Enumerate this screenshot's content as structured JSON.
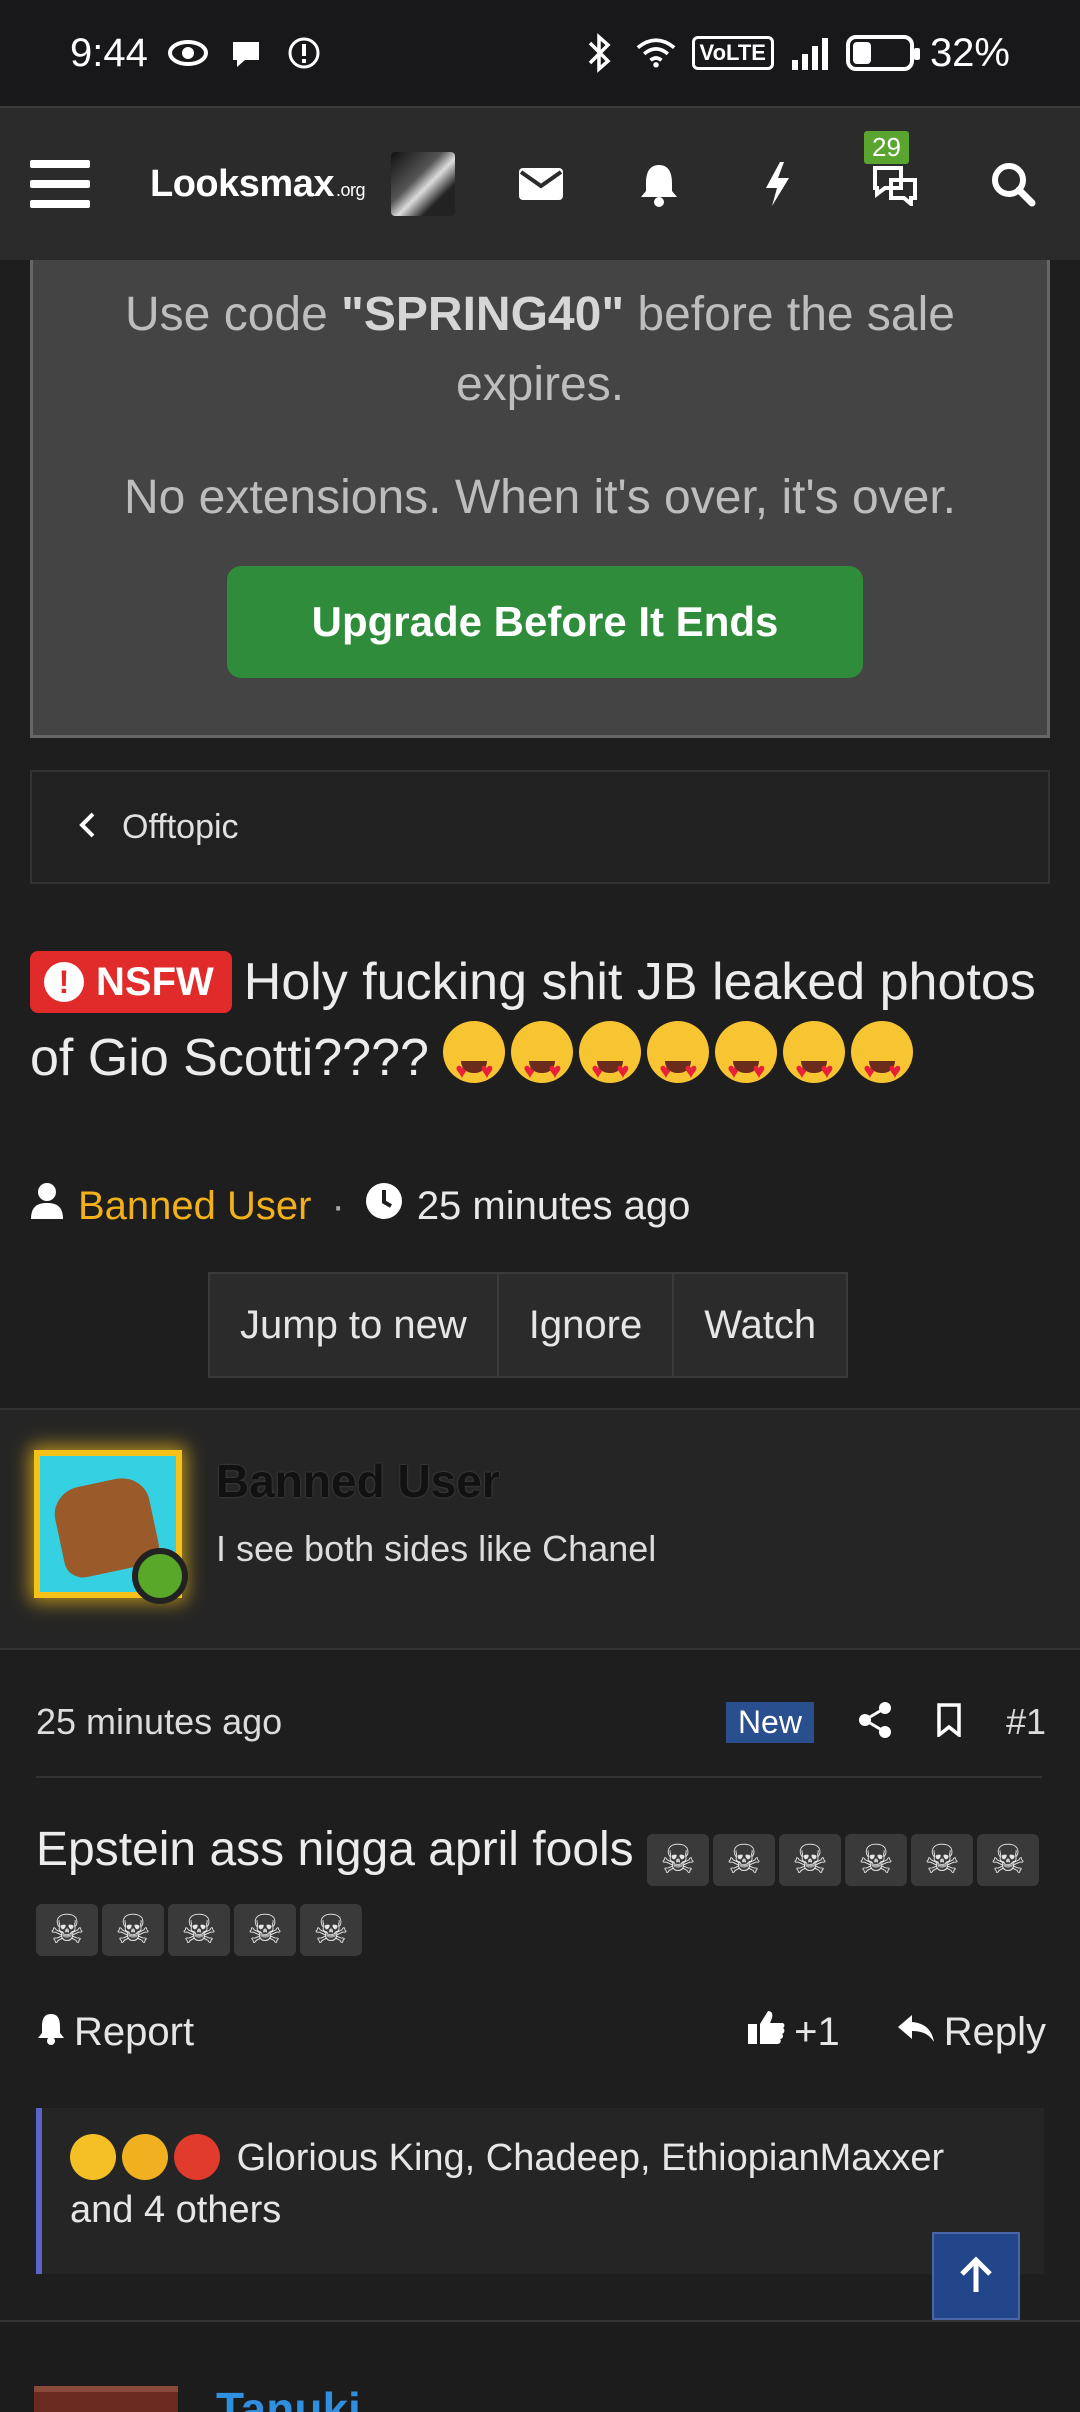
{
  "status_bar": {
    "time": "9:44",
    "battery_pct": "32%",
    "battery_level": 0.32,
    "volte_label": "VoLTE",
    "icons": [
      "eye-icon",
      "chat-bubble-icon",
      "alert-circle-icon",
      "bluetooth-icon",
      "wifi-icon",
      "volte-icon",
      "signal-icon",
      "battery-icon"
    ]
  },
  "header": {
    "logo_text": "Looksmax",
    "logo_suffix": ".org",
    "conversation_badge": "29",
    "icons": [
      "menu-icon",
      "avatar",
      "mail-icon",
      "bell-icon",
      "bolt-icon",
      "conversations-icon",
      "search-icon"
    ]
  },
  "promo": {
    "line1_prefix": "Use code ",
    "line1_code": "\"SPRING40\"",
    "line1_suffix": " before the sale expires.",
    "line2": "No extensions. When it's over, it's over.",
    "button_label": "Upgrade Before It Ends"
  },
  "breadcrumb": {
    "label": "Offtopic"
  },
  "thread": {
    "prefix_label": "NSFW",
    "title": "Holy fucking shit JB leaked photos of Gio Scotti????",
    "title_emoji_count": 7,
    "author": "Banned User",
    "time": "25 minutes ago",
    "buttons": [
      "Jump to new",
      "Ignore",
      "Watch"
    ]
  },
  "post": {
    "username": "Banned User",
    "user_title": "I see both sides like Chanel",
    "time": "25 minutes ago",
    "new_label": "New",
    "post_number": "#1",
    "body_text": "Epstein ass nigga april fools",
    "skull_glyph": "☠",
    "report_label": "Report",
    "like_count": "+1",
    "reply_label": "Reply",
    "reactions_text": "Glorious King, Chadeep, EthiopianMaxxer and 4 others"
  },
  "next_post": {
    "username": "Tanuki"
  },
  "colors": {
    "accent_green": "#2e8c3a",
    "nsfw_red": "#e12a2a",
    "username_gold": "#f2b11b",
    "new_badge_blue": "#2a4f8f",
    "reaction_bar": "#5a64c8"
  }
}
